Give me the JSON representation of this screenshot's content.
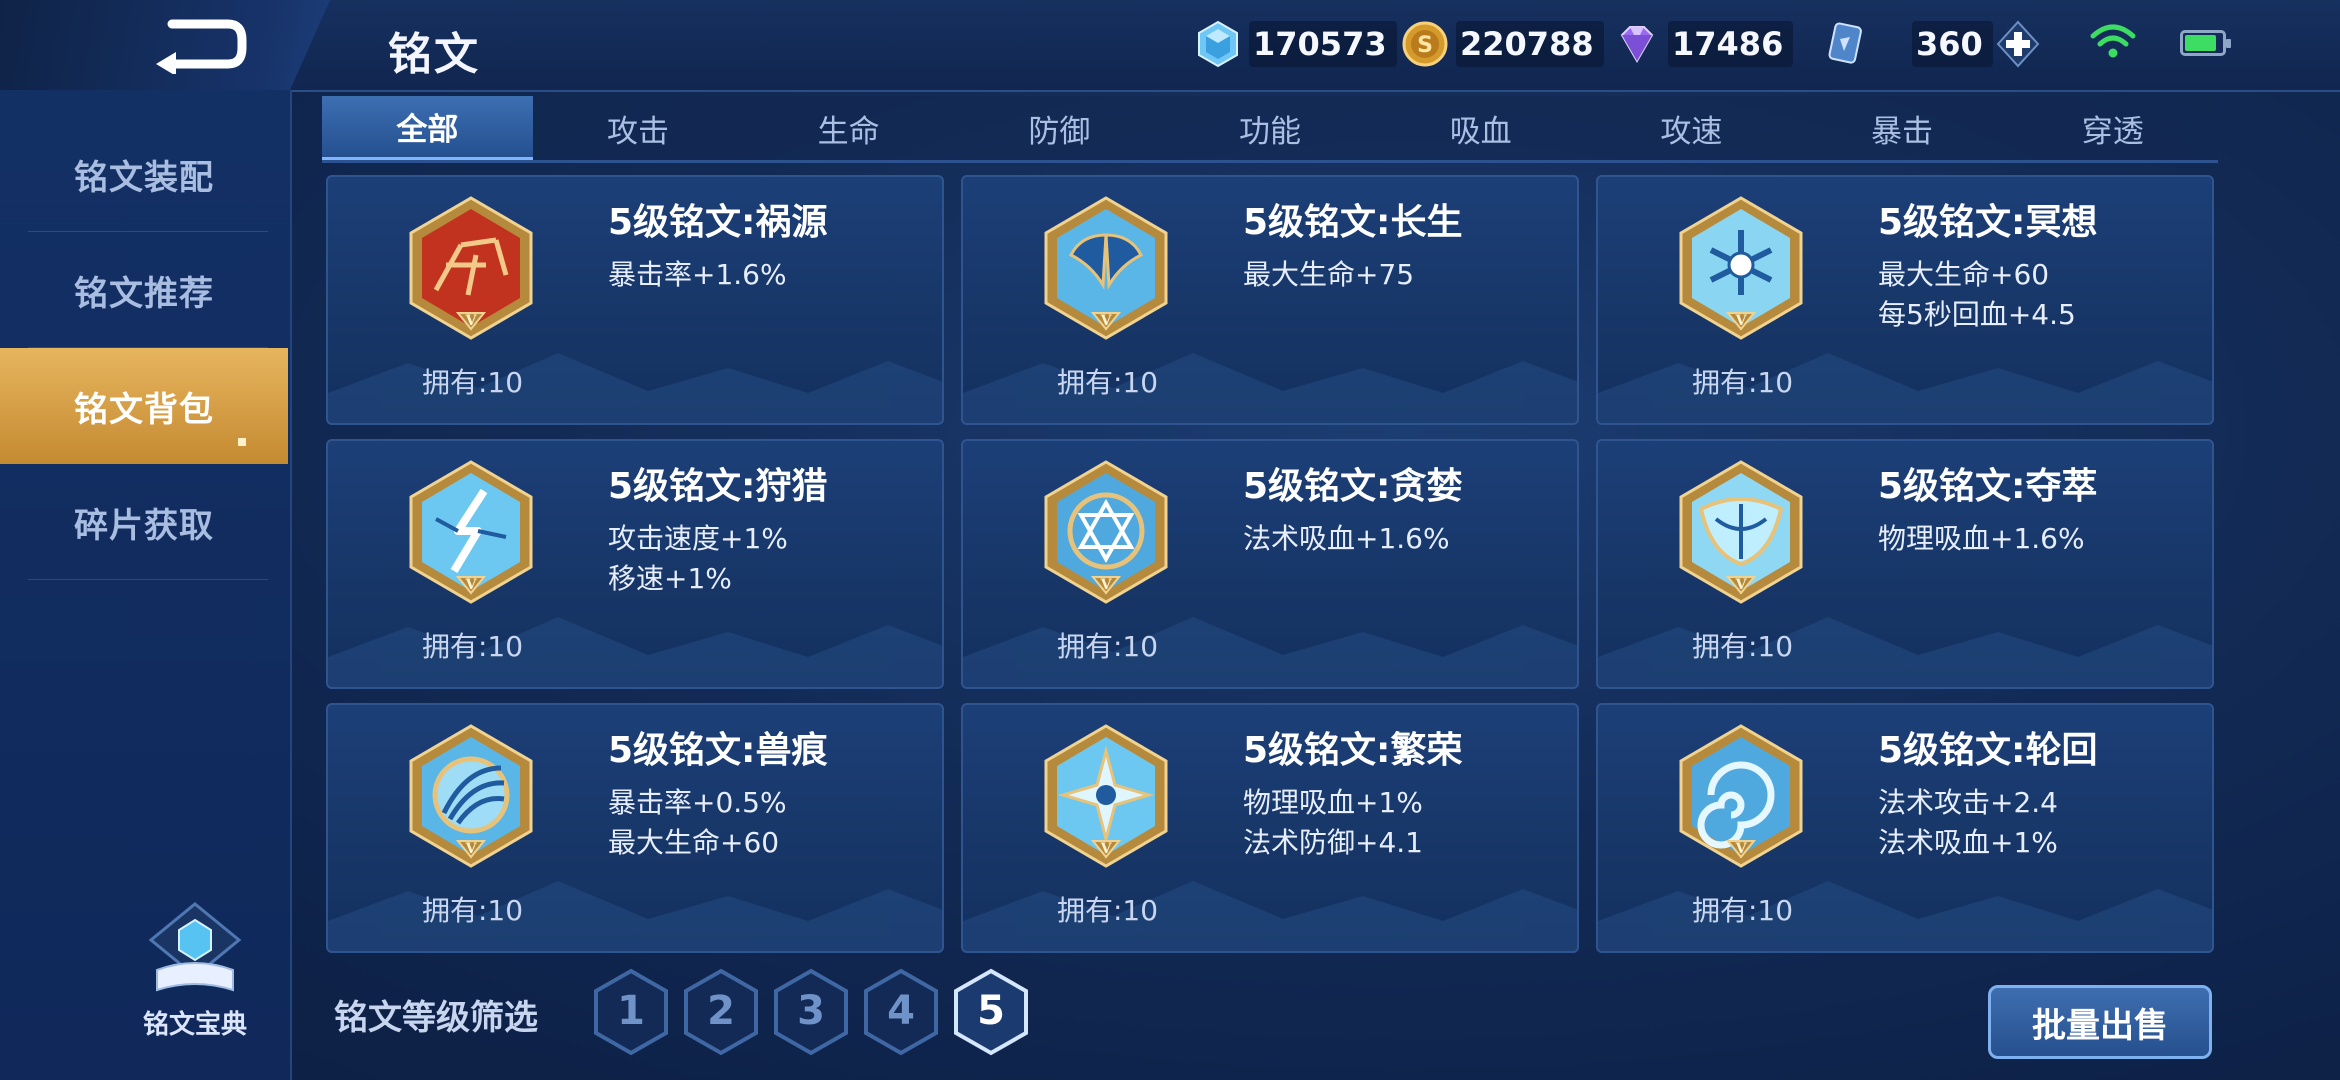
{
  "header": {
    "title": "铭文"
  },
  "resources": [
    {
      "icon": "crystal-icon",
      "value": "170573"
    },
    {
      "icon": "gold-coin-icon",
      "value": "220788"
    },
    {
      "icon": "diamond-icon",
      "value": "17486"
    },
    {
      "icon": "card-voucher-icon",
      "value": "360"
    }
  ],
  "status": {
    "wifi_icon": "wifi-icon",
    "battery_level": 0.85
  },
  "sidebar": {
    "items": [
      {
        "label": "铭文装配"
      },
      {
        "label": "铭文推荐"
      },
      {
        "label": "铭文背包",
        "active": true
      },
      {
        "label": "碎片获取"
      }
    ],
    "codex_label": "铭文宝典"
  },
  "tabs": [
    {
      "label": "全部",
      "active": true
    },
    {
      "label": "攻击"
    },
    {
      "label": "生命"
    },
    {
      "label": "防御"
    },
    {
      "label": "功能"
    },
    {
      "label": "吸血"
    },
    {
      "label": "攻速"
    },
    {
      "label": "暴击"
    },
    {
      "label": "穿透"
    }
  ],
  "runes": [
    {
      "name": "5级铭文:祸源",
      "attrs": [
        "暴击率+1.6%"
      ],
      "owned": "拥有:10",
      "color": "red"
    },
    {
      "name": "5级铭文:长生",
      "attrs": [
        "最大生命+75"
      ],
      "owned": "拥有:10",
      "color": "blue"
    },
    {
      "name": "5级铭文:冥想",
      "attrs": [
        "最大生命+60",
        "每5秒回血+4.5"
      ],
      "owned": "拥有:10",
      "color": "blue"
    },
    {
      "name": "5级铭文:狩猎",
      "attrs": [
        "攻击速度+1%",
        "移速+1%"
      ],
      "owned": "拥有:10",
      "color": "blue"
    },
    {
      "name": "5级铭文:贪婪",
      "attrs": [
        "法术吸血+1.6%"
      ],
      "owned": "拥有:10",
      "color": "blue"
    },
    {
      "name": "5级铭文:夺萃",
      "attrs": [
        "物理吸血+1.6%"
      ],
      "owned": "拥有:10",
      "color": "blue"
    },
    {
      "name": "5级铭文:兽痕",
      "attrs": [
        "暴击率+0.5%",
        "最大生命+60"
      ],
      "owned": "拥有:10",
      "color": "blue"
    },
    {
      "name": "5级铭文:繁荣",
      "attrs": [
        "物理吸血+1%",
        "法术防御+4.1"
      ],
      "owned": "拥有:10",
      "color": "blue"
    },
    {
      "name": "5级铭文:轮回",
      "attrs": [
        "法术攻击+2.4",
        "法术吸血+1%"
      ],
      "owned": "拥有:10",
      "color": "blue"
    }
  ],
  "filter": {
    "label": "铭文等级筛选",
    "levels": [
      "1",
      "2",
      "3",
      "4",
      "5"
    ],
    "active_level": "5"
  },
  "sell_button": "批量出售",
  "colors": {
    "gold": "#c9a24a",
    "accent": "#2c5290",
    "active_tab": "#3d6fb3",
    "active_sidebar": "#d9a248"
  }
}
